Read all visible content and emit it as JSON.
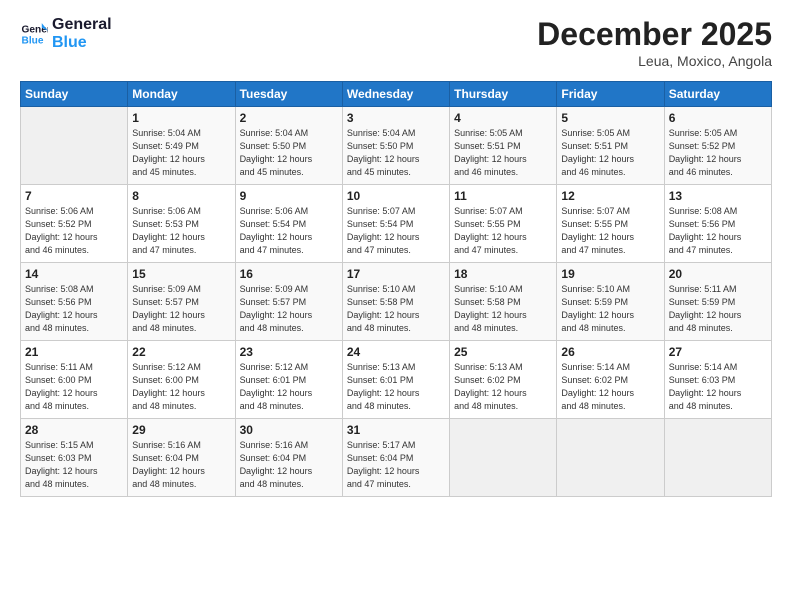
{
  "logo": {
    "line1": "General",
    "line2": "Blue"
  },
  "title": "December 2025",
  "location": "Leua, Moxico, Angola",
  "days_of_week": [
    "Sunday",
    "Monday",
    "Tuesday",
    "Wednesday",
    "Thursday",
    "Friday",
    "Saturday"
  ],
  "weeks": [
    [
      {
        "day": "",
        "info": ""
      },
      {
        "day": "1",
        "info": "Sunrise: 5:04 AM\nSunset: 5:49 PM\nDaylight: 12 hours\nand 45 minutes."
      },
      {
        "day": "2",
        "info": "Sunrise: 5:04 AM\nSunset: 5:50 PM\nDaylight: 12 hours\nand 45 minutes."
      },
      {
        "day": "3",
        "info": "Sunrise: 5:04 AM\nSunset: 5:50 PM\nDaylight: 12 hours\nand 45 minutes."
      },
      {
        "day": "4",
        "info": "Sunrise: 5:05 AM\nSunset: 5:51 PM\nDaylight: 12 hours\nand 46 minutes."
      },
      {
        "day": "5",
        "info": "Sunrise: 5:05 AM\nSunset: 5:51 PM\nDaylight: 12 hours\nand 46 minutes."
      },
      {
        "day": "6",
        "info": "Sunrise: 5:05 AM\nSunset: 5:52 PM\nDaylight: 12 hours\nand 46 minutes."
      }
    ],
    [
      {
        "day": "7",
        "info": "Sunrise: 5:06 AM\nSunset: 5:52 PM\nDaylight: 12 hours\nand 46 minutes."
      },
      {
        "day": "8",
        "info": "Sunrise: 5:06 AM\nSunset: 5:53 PM\nDaylight: 12 hours\nand 47 minutes."
      },
      {
        "day": "9",
        "info": "Sunrise: 5:06 AM\nSunset: 5:54 PM\nDaylight: 12 hours\nand 47 minutes."
      },
      {
        "day": "10",
        "info": "Sunrise: 5:07 AM\nSunset: 5:54 PM\nDaylight: 12 hours\nand 47 minutes."
      },
      {
        "day": "11",
        "info": "Sunrise: 5:07 AM\nSunset: 5:55 PM\nDaylight: 12 hours\nand 47 minutes."
      },
      {
        "day": "12",
        "info": "Sunrise: 5:07 AM\nSunset: 5:55 PM\nDaylight: 12 hours\nand 47 minutes."
      },
      {
        "day": "13",
        "info": "Sunrise: 5:08 AM\nSunset: 5:56 PM\nDaylight: 12 hours\nand 47 minutes."
      }
    ],
    [
      {
        "day": "14",
        "info": "Sunrise: 5:08 AM\nSunset: 5:56 PM\nDaylight: 12 hours\nand 48 minutes."
      },
      {
        "day": "15",
        "info": "Sunrise: 5:09 AM\nSunset: 5:57 PM\nDaylight: 12 hours\nand 48 minutes."
      },
      {
        "day": "16",
        "info": "Sunrise: 5:09 AM\nSunset: 5:57 PM\nDaylight: 12 hours\nand 48 minutes."
      },
      {
        "day": "17",
        "info": "Sunrise: 5:10 AM\nSunset: 5:58 PM\nDaylight: 12 hours\nand 48 minutes."
      },
      {
        "day": "18",
        "info": "Sunrise: 5:10 AM\nSunset: 5:58 PM\nDaylight: 12 hours\nand 48 minutes."
      },
      {
        "day": "19",
        "info": "Sunrise: 5:10 AM\nSunset: 5:59 PM\nDaylight: 12 hours\nand 48 minutes."
      },
      {
        "day": "20",
        "info": "Sunrise: 5:11 AM\nSunset: 5:59 PM\nDaylight: 12 hours\nand 48 minutes."
      }
    ],
    [
      {
        "day": "21",
        "info": "Sunrise: 5:11 AM\nSunset: 6:00 PM\nDaylight: 12 hours\nand 48 minutes."
      },
      {
        "day": "22",
        "info": "Sunrise: 5:12 AM\nSunset: 6:00 PM\nDaylight: 12 hours\nand 48 minutes."
      },
      {
        "day": "23",
        "info": "Sunrise: 5:12 AM\nSunset: 6:01 PM\nDaylight: 12 hours\nand 48 minutes."
      },
      {
        "day": "24",
        "info": "Sunrise: 5:13 AM\nSunset: 6:01 PM\nDaylight: 12 hours\nand 48 minutes."
      },
      {
        "day": "25",
        "info": "Sunrise: 5:13 AM\nSunset: 6:02 PM\nDaylight: 12 hours\nand 48 minutes."
      },
      {
        "day": "26",
        "info": "Sunrise: 5:14 AM\nSunset: 6:02 PM\nDaylight: 12 hours\nand 48 minutes."
      },
      {
        "day": "27",
        "info": "Sunrise: 5:14 AM\nSunset: 6:03 PM\nDaylight: 12 hours\nand 48 minutes."
      }
    ],
    [
      {
        "day": "28",
        "info": "Sunrise: 5:15 AM\nSunset: 6:03 PM\nDaylight: 12 hours\nand 48 minutes."
      },
      {
        "day": "29",
        "info": "Sunrise: 5:16 AM\nSunset: 6:04 PM\nDaylight: 12 hours\nand 48 minutes."
      },
      {
        "day": "30",
        "info": "Sunrise: 5:16 AM\nSunset: 6:04 PM\nDaylight: 12 hours\nand 48 minutes."
      },
      {
        "day": "31",
        "info": "Sunrise: 5:17 AM\nSunset: 6:04 PM\nDaylight: 12 hours\nand 47 minutes."
      },
      {
        "day": "",
        "info": ""
      },
      {
        "day": "",
        "info": ""
      },
      {
        "day": "",
        "info": ""
      }
    ]
  ]
}
